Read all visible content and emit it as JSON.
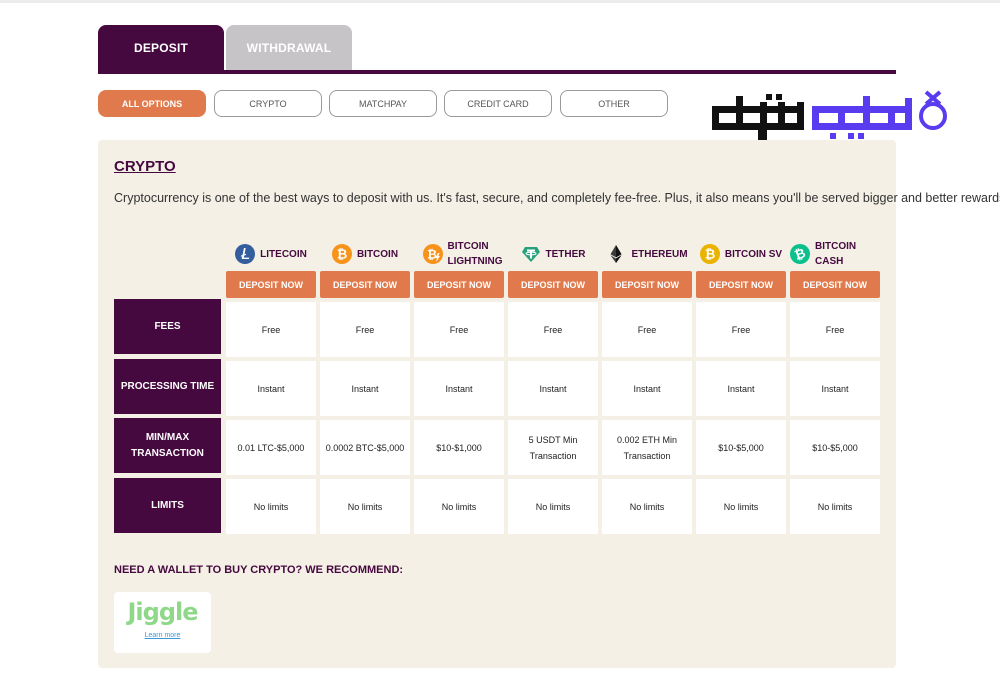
{
  "tabs": [
    {
      "label": "DEPOSIT"
    },
    {
      "label": "WITHDRAWAL"
    }
  ],
  "filters": [
    {
      "label": "ALL OPTIONS"
    },
    {
      "label": "CRYPTO"
    },
    {
      "label": "MATCHPAY"
    },
    {
      "label": "CREDIT CARD"
    },
    {
      "label": "OTHER"
    }
  ],
  "logo": {
    "text": "دیجی‌شرط",
    "colors": {
      "primary": "#5a3cf0",
      "secondary": "#111111"
    }
  },
  "section": {
    "title": "CRYPTO",
    "description": "Cryptocurrency is one of the best ways to deposit with us. It's fast, secure, and completely fee-free. Plus, it also means you'll be served bigger and better rewards!"
  },
  "deposit_label": "DEPOSIT NOW",
  "coins": [
    {
      "name": "LITECOIN",
      "icon": "litecoin-icon",
      "color": "#345d9d"
    },
    {
      "name": "BITCOIN",
      "icon": "bitcoin-icon",
      "color": "#f7931a"
    },
    {
      "name": "BITCOIN LIGHTNING",
      "icon": "bitcoin-lightning-icon",
      "color": "#f7931a"
    },
    {
      "name": "TETHER",
      "icon": "tether-icon",
      "color": "#26a17b"
    },
    {
      "name": "ETHEREUM",
      "icon": "ethereum-icon",
      "color": "#3c3c3d"
    },
    {
      "name": "BITCOIN SV",
      "icon": "bitcoin-sv-icon",
      "color": "#eab300"
    },
    {
      "name": "BITCOIN CASH",
      "icon": "bitcoin-cash-icon",
      "color": "#0ac18e"
    }
  ],
  "rows": [
    {
      "label": "FEES",
      "values": [
        "Free",
        "Free",
        "Free",
        "Free",
        "Free",
        "Free",
        "Free"
      ]
    },
    {
      "label": "PROCESSING TIME",
      "values": [
        "Instant",
        "Instant",
        "Instant",
        "Instant",
        "Instant",
        "Instant",
        "Instant"
      ]
    },
    {
      "label": "MIN/MAX TRANSACTION",
      "values": [
        "0.01 LTC-$5,000",
        "0.0002 BTC-$5,000",
        "$10-$1,000",
        "5 USDT Min Transaction",
        "0.002 ETH Min Transaction",
        "$10-$5,000",
        "$10-$5,000"
      ]
    },
    {
      "label": "LIMITS",
      "values": [
        "No limits",
        "No limits",
        "No limits",
        "No limits",
        "No limits",
        "No limits",
        "No limits"
      ]
    }
  ],
  "wallet": {
    "title": "NEED A WALLET TO BUY CRYPTO? WE RECOMMEND:",
    "name": "Jiggle",
    "link": "Learn more"
  }
}
